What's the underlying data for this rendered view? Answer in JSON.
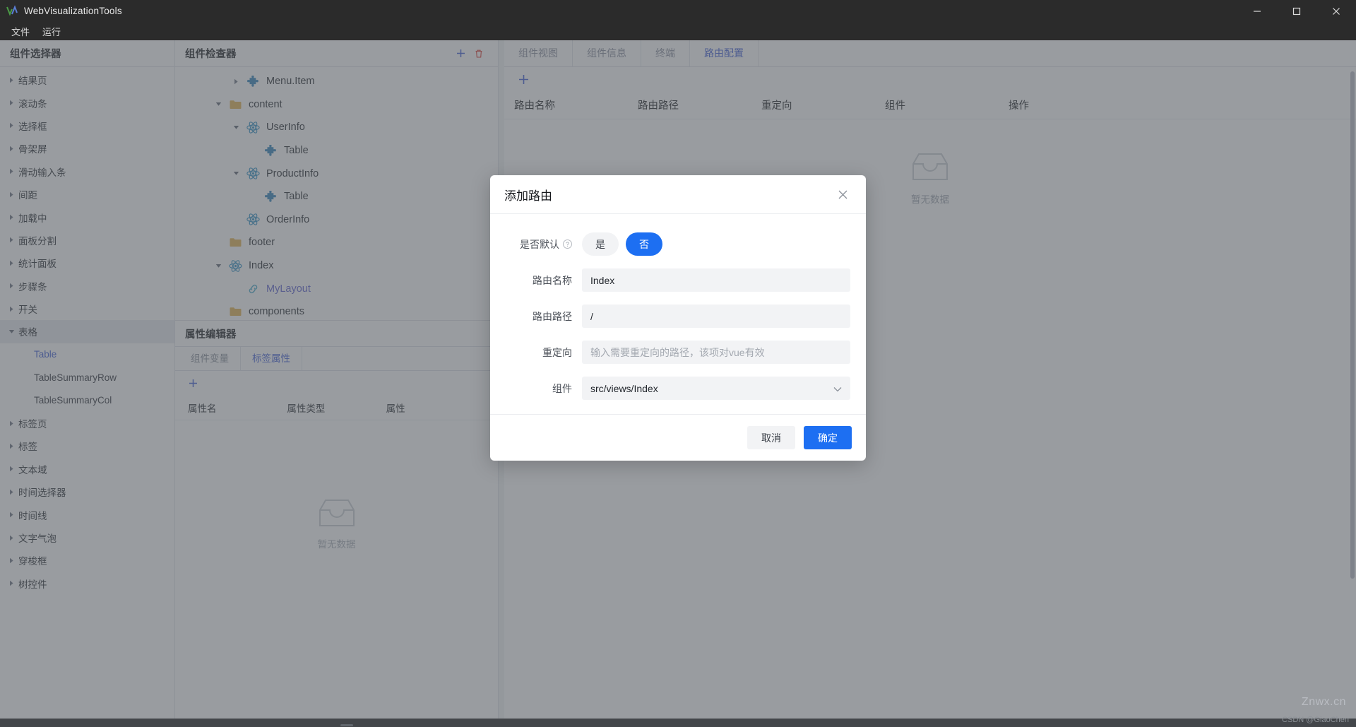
{
  "titlebar": {
    "app_title": "WebVisualizationTools",
    "minimize": "minimize-icon",
    "maximize": "maximize-icon",
    "close": "close-icon"
  },
  "menubar": {
    "items": [
      {
        "label": "文件"
      },
      {
        "label": "运行"
      }
    ]
  },
  "left_panel": {
    "header": "组件选择器",
    "items": [
      {
        "label": "结果页",
        "expandable": true,
        "expanded": false
      },
      {
        "label": "滚动条",
        "expandable": true,
        "expanded": false
      },
      {
        "label": "选择框",
        "expandable": true,
        "expanded": false
      },
      {
        "label": "骨架屏",
        "expandable": true,
        "expanded": false
      },
      {
        "label": "滑动输入条",
        "expandable": true,
        "expanded": false
      },
      {
        "label": "间距",
        "expandable": true,
        "expanded": false
      },
      {
        "label": "加载中",
        "expandable": true,
        "expanded": false
      },
      {
        "label": "面板分割",
        "expandable": true,
        "expanded": false
      },
      {
        "label": "统计面板",
        "expandable": true,
        "expanded": false
      },
      {
        "label": "步骤条",
        "expandable": true,
        "expanded": false
      },
      {
        "label": "开关",
        "expandable": true,
        "expanded": false
      },
      {
        "label": "表格",
        "expandable": true,
        "expanded": true,
        "active": true
      },
      {
        "label": "Table",
        "child": true,
        "selected": true
      },
      {
        "label": "TableSummaryRow",
        "child": true
      },
      {
        "label": "TableSummaryCol",
        "child": true
      },
      {
        "label": "标签页",
        "expandable": true,
        "expanded": false
      },
      {
        "label": "标签",
        "expandable": true,
        "expanded": false
      },
      {
        "label": "文本域",
        "expandable": true,
        "expanded": false
      },
      {
        "label": "时间选择器",
        "expandable": true,
        "expanded": false
      },
      {
        "label": "时间线",
        "expandable": true,
        "expanded": false
      },
      {
        "label": "文字气泡",
        "expandable": true,
        "expanded": false
      },
      {
        "label": "穿梭框",
        "expandable": true,
        "expanded": false
      },
      {
        "label": "树控件",
        "expandable": true,
        "expanded": false
      }
    ]
  },
  "mid_panel": {
    "header": "组件检查器",
    "add_icon": "plus-icon",
    "delete_icon": "trash-icon",
    "tree": [
      {
        "label": "Menu.Item",
        "icon": "puzzle-icon",
        "indent": 3,
        "caret": "right"
      },
      {
        "label": "content",
        "icon": "folder-icon",
        "indent": 2,
        "caret": "down"
      },
      {
        "label": "UserInfo",
        "icon": "react-icon",
        "indent": 3,
        "caret": "down"
      },
      {
        "label": "Table",
        "icon": "puzzle-icon",
        "indent": 4,
        "caret": "none"
      },
      {
        "label": "ProductInfo",
        "icon": "react-icon",
        "indent": 3,
        "caret": "down"
      },
      {
        "label": "Table",
        "icon": "puzzle-icon",
        "indent": 4,
        "caret": "none"
      },
      {
        "label": "OrderInfo",
        "icon": "react-icon",
        "indent": 3,
        "caret": "none"
      },
      {
        "label": "footer",
        "icon": "folder-icon",
        "indent": 2,
        "caret": "none"
      },
      {
        "label": "Index",
        "icon": "react-icon",
        "indent": 2,
        "caret": "down"
      },
      {
        "label": "MyLayout",
        "icon": "link-icon",
        "indent": 3,
        "caret": "none",
        "link": true
      },
      {
        "label": "components",
        "icon": "folder-icon",
        "indent": 2,
        "caret": "none"
      }
    ],
    "property_editor": {
      "header": "属性编辑器",
      "tabs": [
        {
          "label": "组件变量",
          "active": false
        },
        {
          "label": "标签属性",
          "active": true
        }
      ],
      "add_icon": "plus-icon",
      "columns": [
        "属性名",
        "属性类型",
        "属性"
      ],
      "empty_text": "暂无数据",
      "empty_icon": "empty-box-icon"
    }
  },
  "right_panel": {
    "tabs": [
      {
        "label": "组件视图",
        "active": false
      },
      {
        "label": "组件信息",
        "active": false
      },
      {
        "label": "终端",
        "active": false
      },
      {
        "label": "路由配置",
        "active": true
      }
    ],
    "add_icon": "plus-icon",
    "columns": [
      "路由名称",
      "路由路径",
      "重定向",
      "组件",
      "操作"
    ],
    "empty_text": "暂无数据",
    "empty_icon": "empty-box-icon"
  },
  "modal": {
    "title": "添加路由",
    "close_icon": "close-icon",
    "fields": {
      "is_default": {
        "label": "是否默认",
        "help_icon": "question-icon",
        "options": [
          {
            "label": "是",
            "selected": false
          },
          {
            "label": "否",
            "selected": true
          }
        ]
      },
      "route_name": {
        "label": "路由名称",
        "value": "Index",
        "placeholder": ""
      },
      "route_path": {
        "label": "路由路径",
        "value": "/",
        "placeholder": ""
      },
      "redirect": {
        "label": "重定向",
        "value": "",
        "placeholder": "输入需要重定向的路径，该项对vue有效"
      },
      "component": {
        "label": "组件",
        "value": "src/views/Index",
        "chevron": "chevron-down-icon"
      }
    },
    "buttons": {
      "cancel": "取消",
      "confirm": "确定"
    }
  },
  "watermarks": {
    "primary": "Znwx.cn",
    "secondary": "CSDN @GiaoChen"
  },
  "colors": {
    "accent": "#1d6ff2",
    "tab_active": "#3858d6",
    "titlebar_bg": "#2b2b2b",
    "panel_bg": "#ffffff",
    "input_bg": "#f2f3f5",
    "danger": "#d93025"
  }
}
